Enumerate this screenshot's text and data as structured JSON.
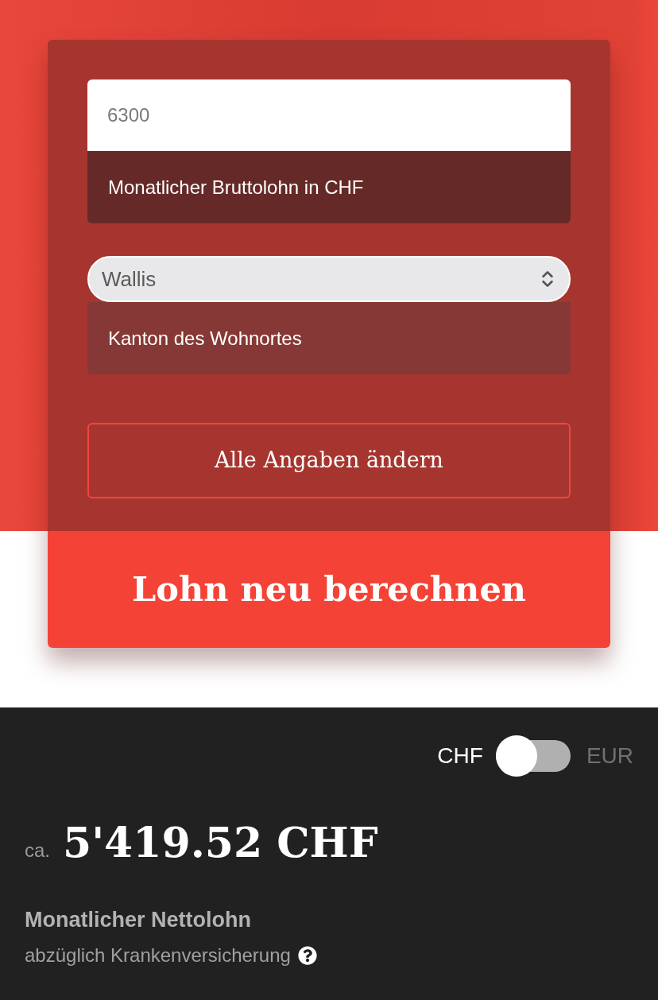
{
  "gross_salary": {
    "value": "6300",
    "label": "Monatlicher Bruttolohn in CHF"
  },
  "canton": {
    "value": "Wallis",
    "label": "Kanton des Wohnortes"
  },
  "edit_button": "Alle Angaben ändern",
  "recalculate_button": "Lohn neu berechnen",
  "currency_switch": {
    "options": [
      {
        "label": "CHF",
        "selected": true
      },
      {
        "label": "EUR",
        "selected": false
      }
    ]
  },
  "result": {
    "prefix": "ca.",
    "amount": "5'419.52 CHF",
    "title": "Monatlicher Nettolohn",
    "subtitle": "abzüglich Krankenversicherung"
  }
}
